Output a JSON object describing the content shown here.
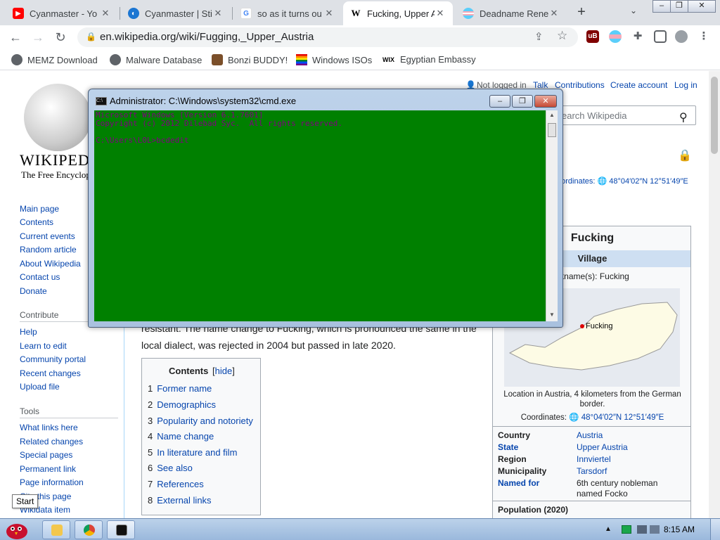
{
  "tabs": [
    {
      "title": "Cyanmaster - Yo",
      "icon": "youtube-icon",
      "color": "#ff0000"
    },
    {
      "title": "Cyanmaster | Sti",
      "icon": "steam-icon",
      "color": "#1b76d2"
    },
    {
      "title": "so as it turns ou",
      "icon": "google-icon",
      "color": "#4285f4"
    },
    {
      "title": "Fucking, Upper A",
      "icon": "wikipedia-icon",
      "color": "#000000"
    },
    {
      "title": "Deadname Rene",
      "icon": "trans-flag-icon",
      "color": "#5bcefa"
    }
  ],
  "new_tab": "+",
  "tab_list": "⌄",
  "window_buttons": {
    "minimize": "–",
    "maximize": "❐",
    "close": "✕"
  },
  "address_bar": {
    "url": "en.wikipedia.org/wiki/Fugging,_Upper_Austria"
  },
  "bookmarks": [
    "MEMZ Download",
    "Malware Database",
    "Bonzi BUDDY!",
    "Windows ISOs",
    "Egyptian Embassy"
  ],
  "bookmark_wix_label": "WIX",
  "wiki": {
    "logo_name": "WIKIPEDI",
    "tagline": "The Free Encyclop",
    "top_links": [
      "Not logged in",
      "Talk",
      "Contributions",
      "Create account",
      "Log in"
    ],
    "search_placeholder": "earch Wikipedia",
    "coord_top": "oordinates: 🌐 48°04′02″N 12°51′49″E",
    "nav_links": [
      "Main page",
      "Contents",
      "Current events",
      "Random article",
      "About Wikipedia",
      "Contact us",
      "Donate"
    ],
    "contribute_head": "Contribute",
    "contribute_links": [
      "Help",
      "Learn to edit",
      "Community portal",
      "Recent changes",
      "Upload file"
    ],
    "tools_head": "Tools",
    "tools_links": [
      "What links here",
      "Related changes",
      "Special pages",
      "Permanent link",
      "Page information",
      "Cite this page",
      "Wikidata item"
    ],
    "body_lines": [
      "resistant. The name change to Fucking, which is pronounced the same in the",
      "local dialect, was rejected in 2004 but passed in late 2020."
    ],
    "toc": {
      "title": "Contents",
      "hide": "hide",
      "items": [
        {
          "num": "1",
          "label": "Former name"
        },
        {
          "num": "2",
          "label": "Demographics"
        },
        {
          "num": "3",
          "label": "Popularity and notoriety"
        },
        {
          "num": "4",
          "label": "Name change"
        },
        {
          "num": "5",
          "label": "In literature and film"
        },
        {
          "num": "6",
          "label": "See also"
        },
        {
          "num": "7",
          "label": "References"
        },
        {
          "num": "8",
          "label": "External links"
        }
      ]
    },
    "infobox": {
      "title": "Fucking",
      "type": "Village",
      "nickname": "ckname(s): Fucking",
      "map_label": "Fucking",
      "caption": "Location in Austria, 4 kilometers from the German border.",
      "coord_label": "Coordinates:",
      "coord_value": "48°04′02″N 12°51′49″E",
      "rows": [
        {
          "key": "Country",
          "value": "Austria",
          "key_link": false,
          "val_link": true
        },
        {
          "key": "State",
          "value": "Upper Austria",
          "key_link": true,
          "val_link": true
        },
        {
          "key": "Region",
          "value": "Innviertel",
          "key_link": false,
          "val_link": true
        },
        {
          "key": "Municipality",
          "value": "Tarsdorf",
          "key_link": false,
          "val_link": true
        },
        {
          "key": "Named for",
          "value": "6th century nobleman named Focko",
          "key_link": true,
          "val_link": false
        }
      ],
      "population_label": "Population (2020)"
    }
  },
  "cmd": {
    "title": "Administrator: C:\\Windows\\system32\\cmd.exe",
    "lines": [
      "Microsoft Windows [Version 6.1.7601]",
      "Copyright (c) 2012 Dilebad Syc.  All rights reserved.",
      "",
      "C:\\Users\\LOL>bcdedit"
    ]
  },
  "taskbar": {
    "start_tooltip": "Start",
    "clock": "8:15 AM"
  }
}
